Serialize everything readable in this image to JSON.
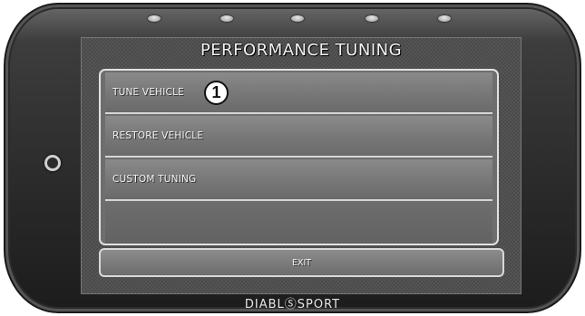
{
  "screen": {
    "title": "PERFORMANCE TUNING",
    "menu_items": [
      {
        "label": "TUNE VEHICLE"
      },
      {
        "label": "RESTORE VEHICLE"
      },
      {
        "label": "CUSTOM TUNING"
      },
      {
        "label": ""
      }
    ],
    "exit_label": "EXIT"
  },
  "callout": {
    "number": "1"
  },
  "device": {
    "brand": "DIABLⓈSPORT",
    "home_button_icon": "power-ring-icon",
    "indicator_led_count": 5
  },
  "colors": {
    "bezel": "#2a2a2a",
    "screen_bg": "#4a4a4a",
    "menu_item": "#7a7a7a",
    "border_highlight": "#e2e2e2"
  }
}
